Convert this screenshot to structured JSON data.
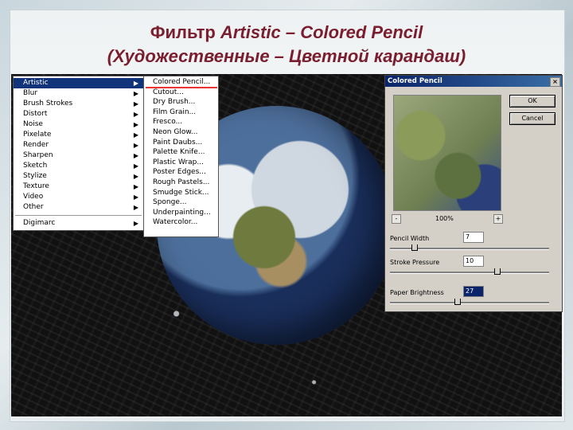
{
  "title": {
    "line1_prefix": "Фильтр ",
    "line1_italic": "Artistic – Colored Pencil",
    "line2": "(Художественные – Цветной карандаш)"
  },
  "menu": {
    "items": [
      {
        "label": "Artistic",
        "selected": true,
        "has_submenu": true
      },
      {
        "label": "Blur",
        "selected": false,
        "has_submenu": true
      },
      {
        "label": "Brush Strokes",
        "selected": false,
        "has_submenu": true
      },
      {
        "label": "Distort",
        "selected": false,
        "has_submenu": true
      },
      {
        "label": "Noise",
        "selected": false,
        "has_submenu": true
      },
      {
        "label": "Pixelate",
        "selected": false,
        "has_submenu": true
      },
      {
        "label": "Render",
        "selected": false,
        "has_submenu": true
      },
      {
        "label": "Sharpen",
        "selected": false,
        "has_submenu": true
      },
      {
        "label": "Sketch",
        "selected": false,
        "has_submenu": true
      },
      {
        "label": "Stylize",
        "selected": false,
        "has_submenu": true
      },
      {
        "label": "Texture",
        "selected": false,
        "has_submenu": true
      },
      {
        "label": "Video",
        "selected": false,
        "has_submenu": true
      },
      {
        "label": "Other",
        "selected": false,
        "has_submenu": true
      }
    ],
    "footer_item": "Digimarc"
  },
  "submenu": {
    "items": [
      "Colored Pencil...",
      "Cutout...",
      "Dry Brush...",
      "Film Grain...",
      "Fresco...",
      "Neon Glow...",
      "Paint Daubs...",
      "Palette Knife...",
      "Plastic Wrap...",
      "Poster Edges...",
      "Rough Pastels...",
      "Smudge Stick...",
      "Sponge...",
      "Underpainting...",
      "Watercolor..."
    ]
  },
  "dialog": {
    "title": "Colored Pencil",
    "close_glyph": "×",
    "ok_label": "OK",
    "cancel_label": "Cancel",
    "zoom_minus": "-",
    "zoom_plus": "+",
    "zoom": "100%",
    "params": [
      {
        "label": "Pencil Width",
        "value": "7",
        "slider_fraction": 0.15,
        "highlight": false
      },
      {
        "label": "Stroke Pressure",
        "value": "10",
        "slider_fraction": 0.67,
        "highlight": false
      },
      {
        "label": "Paper Brightness",
        "value": "27",
        "slider_fraction": 0.42,
        "highlight": true
      }
    ]
  },
  "colors": {
    "title": "#7a1d2e",
    "menu_selection": "#11337a",
    "accent_underline": "#e33333",
    "dialog_titlebar": "#0a246a"
  }
}
